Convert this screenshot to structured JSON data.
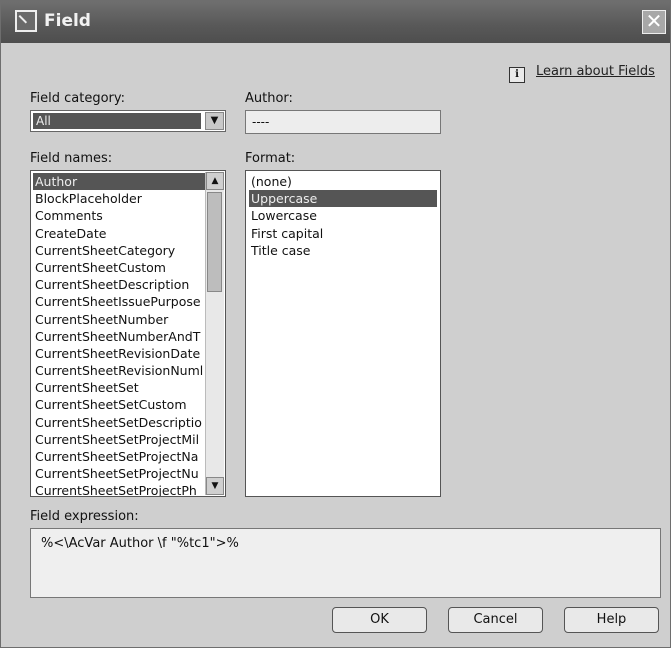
{
  "window": {
    "title": "Field",
    "close_glyph": "✕",
    "app_icon": "field-app-icon"
  },
  "help_link": {
    "icon_glyph": "i",
    "label": "Learn about Fields"
  },
  "field_category": {
    "label": "Field category:",
    "value": "All"
  },
  "author": {
    "label": "Author:",
    "value": "----"
  },
  "field_names": {
    "label": "Field names:",
    "selected": "Author",
    "items": [
      "Author",
      "BlockPlaceholder",
      "Comments",
      "CreateDate",
      "CurrentSheetCategory",
      "CurrentSheetCustom",
      "CurrentSheetDescription",
      "CurrentSheetIssuePurpose",
      "CurrentSheetNumber",
      "CurrentSheetNumberAndT",
      "CurrentSheetRevisionDate",
      "CurrentSheetRevisionNuml",
      "CurrentSheetSet",
      "CurrentSheetSetCustom",
      "CurrentSheetSetDescriptio",
      "CurrentSheetSetProjectMil",
      "CurrentSheetSetProjectNa",
      "CurrentSheetSetProjectNu",
      "CurrentSheetSetProjectPh"
    ]
  },
  "format": {
    "label": "Format:",
    "selected": "Uppercase",
    "items": [
      "(none)",
      "Uppercase",
      "Lowercase",
      "First capital",
      "Title case"
    ]
  },
  "field_expression": {
    "label": "Field expression:",
    "value": "%<\\AcVar Author \\f \"%tc1\">%"
  },
  "buttons": {
    "ok": "OK",
    "cancel": "Cancel",
    "help": "Help"
  },
  "colors": {
    "selection": "#555555",
    "titlebar": "#5a5a5a",
    "dialog": "#cfcfcf"
  }
}
